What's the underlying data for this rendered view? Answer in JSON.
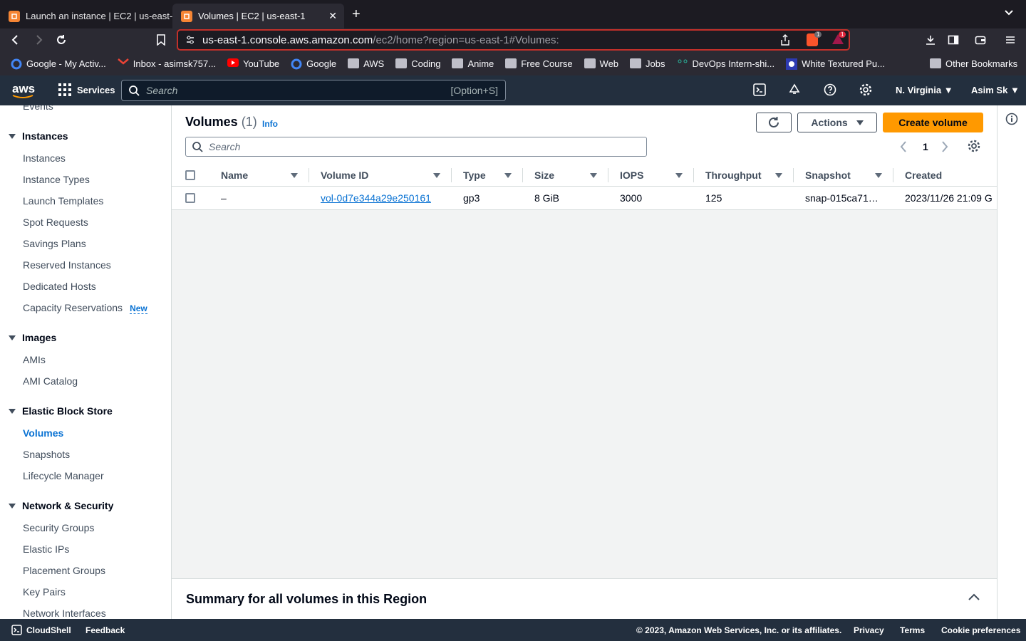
{
  "browser": {
    "tabs": [
      {
        "title": "Launch an instance | EC2 | us-east-",
        "active": false
      },
      {
        "title": "Volumes | EC2 | us-east-1",
        "active": true
      }
    ],
    "url_host": "us-east-1.console.aws.amazon.com",
    "url_path": "/ec2/home?region=us-east-1#Volumes:",
    "brave_badge": "1",
    "rewards_badge": "1",
    "bookmarks": [
      {
        "label": "Google - My Activ...",
        "icon": "google-icon"
      },
      {
        "label": "Inbox - asimsk757...",
        "icon": "gmail-icon"
      },
      {
        "label": "YouTube",
        "icon": "youtube-icon"
      },
      {
        "label": "Google",
        "icon": "google-icon"
      },
      {
        "label": "AWS",
        "icon": "folder-icon"
      },
      {
        "label": "Coding",
        "icon": "folder-icon"
      },
      {
        "label": "Anime",
        "icon": "folder-icon"
      },
      {
        "label": "Free Course",
        "icon": "folder-icon"
      },
      {
        "label": "Web",
        "icon": "folder-icon"
      },
      {
        "label": "Jobs",
        "icon": "folder-icon"
      },
      {
        "label": "DevOps Intern-shi...",
        "icon": "devops-icon"
      },
      {
        "label": "White Textured Pu...",
        "icon": "site-icon"
      }
    ],
    "other_bookmarks": "Other Bookmarks"
  },
  "aws_nav": {
    "logo": "aws",
    "services": "Services",
    "search_placeholder": "Search",
    "search_shortcut": "[Option+S]",
    "region": "N. Virginia",
    "user": "Asim Sk"
  },
  "sidebar": {
    "partial_item": "Events",
    "sections": [
      {
        "title": "Instances",
        "items": [
          "Instances",
          "Instance Types",
          "Launch Templates",
          "Spot Requests",
          "Savings Plans",
          "Reserved Instances",
          "Dedicated Hosts",
          "Capacity Reservations"
        ]
      },
      {
        "title": "Images",
        "items": [
          "AMIs",
          "AMI Catalog"
        ]
      },
      {
        "title": "Elastic Block Store",
        "items": [
          "Volumes",
          "Snapshots",
          "Lifecycle Manager"
        ]
      },
      {
        "title": "Network & Security",
        "items": [
          "Security Groups",
          "Elastic IPs",
          "Placement Groups",
          "Key Pairs",
          "Network Interfaces"
        ]
      }
    ],
    "new_badge": "New",
    "active_item": "Volumes"
  },
  "volumes": {
    "title": "Volumes",
    "count": "(1)",
    "info": "Info",
    "actions": "Actions",
    "create": "Create volume",
    "search_placeholder": "Search",
    "page": "1",
    "columns": [
      "Name",
      "Volume ID",
      "Type",
      "Size",
      "IOPS",
      "Throughput",
      "Snapshot",
      "Created"
    ],
    "rows": [
      {
        "name": "–",
        "volume_id": "vol-0d7e344a29e250161",
        "type": "gp3",
        "size": "8 GiB",
        "iops": "3000",
        "throughput": "125",
        "snapshot": "snap-015ca71…",
        "created": "2023/11/26 21:09 G"
      }
    ],
    "summary": "Summary for all volumes in this Region"
  },
  "footer": {
    "cloudshell": "CloudShell",
    "feedback": "Feedback",
    "copyright": "© 2023, Amazon Web Services, Inc. or its affiliates.",
    "privacy": "Privacy",
    "terms": "Terms",
    "cookie": "Cookie preferences"
  },
  "colors": {
    "accent": "#0972d3",
    "primary_button": "#ff9900",
    "nav_bg": "#232f3e",
    "url_border": "#c3302a"
  }
}
